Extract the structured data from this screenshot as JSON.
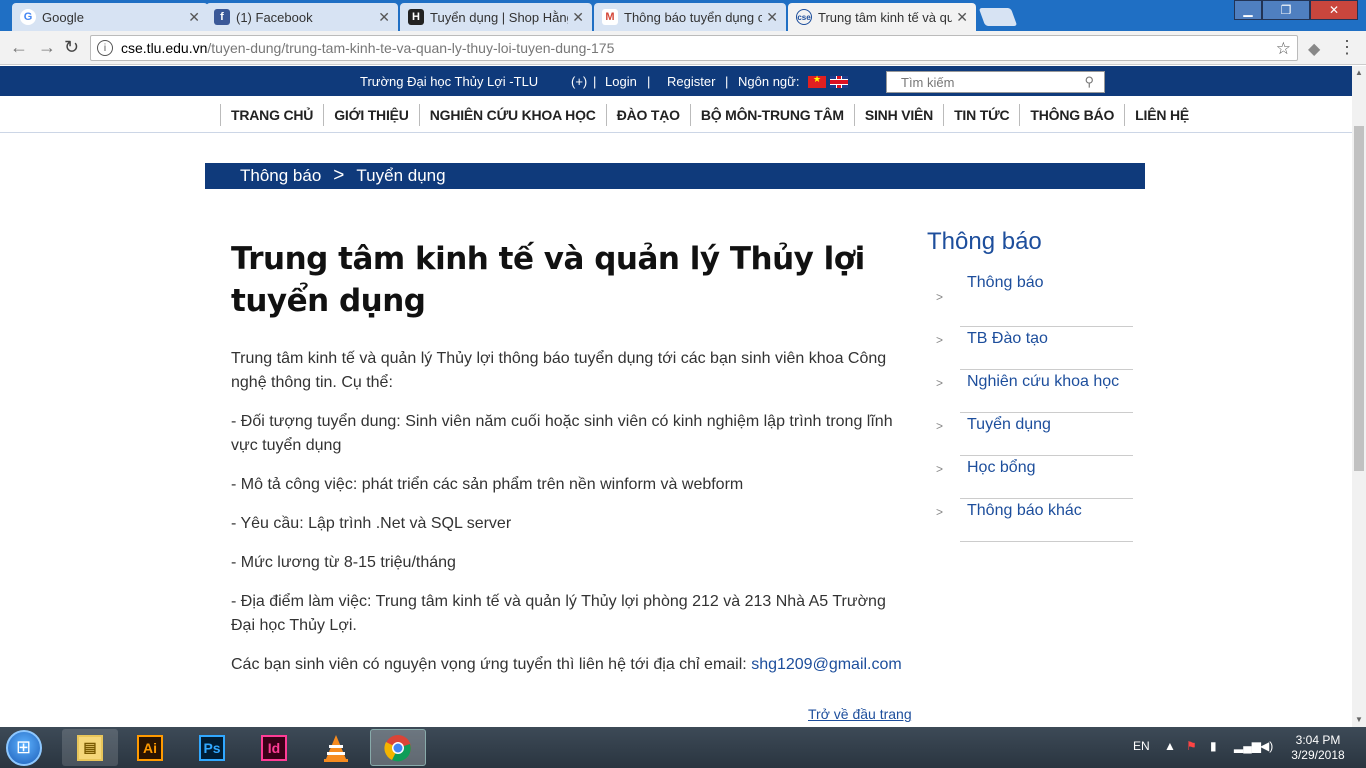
{
  "browser": {
    "tabs": [
      {
        "title": "Google",
        "icon": "google-icon"
      },
      {
        "title": "(1) Facebook",
        "icon": "facebook-icon"
      },
      {
        "title": "Tuyển dụng | Shop Hằng",
        "icon": "shop-icon"
      },
      {
        "title": "Thông báo tuyển dụng c",
        "icon": "gmail-icon"
      },
      {
        "title": "Trung tâm kinh tế và quả",
        "icon": "cse-icon"
      }
    ],
    "url_host": "cse.tlu.edu.vn",
    "url_path": "/tuyen-dung/trung-tam-kinh-te-va-quan-ly-thuy-loi-tuyen-dung-175"
  },
  "topbar": {
    "university": "Trường Đại học Thủy Lợi -TLU",
    "plus": "(+)",
    "login": "Login",
    "register": "Register",
    "language_label": "Ngôn ngữ:",
    "search_placeholder": "Tìm kiếm"
  },
  "nav": {
    "items": [
      "TRANG CHỦ",
      "GIỚI THIỆU",
      "NGHIÊN CỨU KHOA HỌC",
      "ĐÀO TẠO",
      "BỘ MÔN-TRUNG TÂM",
      "SINH VIÊN",
      "TIN TỨC",
      "THÔNG BÁO",
      "LIÊN HỆ"
    ]
  },
  "breadcrumb": {
    "parent": "Thông báo",
    "separator": ">",
    "current": "Tuyển dụng"
  },
  "article": {
    "title": "Trung tâm kinh tế và quản lý Thủy lợi tuyển dụng",
    "paragraphs": [
      "Trung tâm kinh tế và quản lý Thủy lợi thông báo tuyển dụng tới các bạn sinh viên khoa Công nghệ thông tin. Cụ thể:",
      "- Đối tượng tuyển dung: Sinh viên năm cuối hoặc sinh viên có kinh nghiệm lập trình trong lĩnh vực tuyển dụng",
      "- Mô tả công việc: phát triển các sản phẩm trên nền winform và webform",
      "- Yêu cầu: Lập trình .Net và SQL server",
      "- Mức lương từ 8-15 triệu/tháng",
      "- Địa điểm làm việc: Trung tâm kinh tế và quản lý Thủy lợi phòng 212 và 213 Nhà A5 Trường Đại học Thủy Lợi."
    ],
    "contact_text": "Các bạn sinh viên có nguyện vọng ứng tuyển thì liên hệ tới địa chỉ email: ",
    "email": "shg1209@gmail.com",
    "back_to_top": "Trở về đầu trang"
  },
  "sidebar": {
    "title": "Thông báo",
    "items": [
      "Thông báo",
      "TB Đào tạo",
      "Nghiên cứu khoa học",
      "Tuyển dụng",
      "Học bổng",
      "Thông báo khác"
    ]
  },
  "taskbar": {
    "language": "EN",
    "time": "3:04 PM",
    "date": "3/29/2018",
    "apps": [
      "explorer-icon",
      "illustrator-icon",
      "photoshop-icon",
      "indesign-icon",
      "vlc-icon",
      "chrome-icon"
    ],
    "app_labels": {
      "ai": "Ai",
      "ps": "Ps",
      "id": "Id"
    }
  },
  "colors": {
    "brand_blue": "#0f3a7b",
    "link_blue": "#1d4e9c"
  }
}
